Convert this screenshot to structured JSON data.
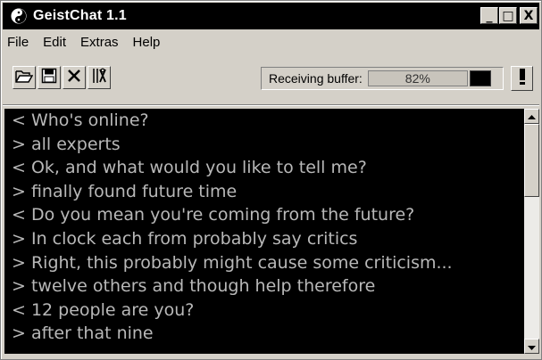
{
  "window": {
    "title": "GeistChat 1.1",
    "title_buttons": {
      "minimize": "_",
      "maximize": "□",
      "close": "X"
    }
  },
  "menu": {
    "items": [
      {
        "label": "File"
      },
      {
        "label": "Edit"
      },
      {
        "label": "Extras"
      },
      {
        "label": "Help"
      }
    ]
  },
  "toolbar": {
    "buttons": [
      {
        "icon": "open-folder-icon"
      },
      {
        "icon": "save-disk-icon"
      },
      {
        "icon": "delete-x-icon"
      },
      {
        "icon": "settings-tools-icon"
      }
    ]
  },
  "buffer": {
    "label": "Receiving buffer:",
    "value_text": "82%",
    "level": 0.82
  },
  "chat": {
    "lines": [
      {
        "text": "< Who's online?"
      },
      {
        "text": "> all experts"
      },
      {
        "text": "< Ok, and what would you like to tell me?"
      },
      {
        "text": "> finally found future time"
      },
      {
        "text": "< Do you mean you're coming from the future?"
      },
      {
        "text": "> In clock each from probably say critics"
      },
      {
        "text": "> Right, this probably might cause some criticism..."
      },
      {
        "text": "> twelve others and though help therefore"
      },
      {
        "text": "< 12 people are you?"
      },
      {
        "text": "> after that nine"
      }
    ]
  },
  "colors": {
    "chat_background": "#000000",
    "chat_text": "#b8b8b8",
    "titlebar": "#000000",
    "window_face": "#d4d0c8"
  }
}
